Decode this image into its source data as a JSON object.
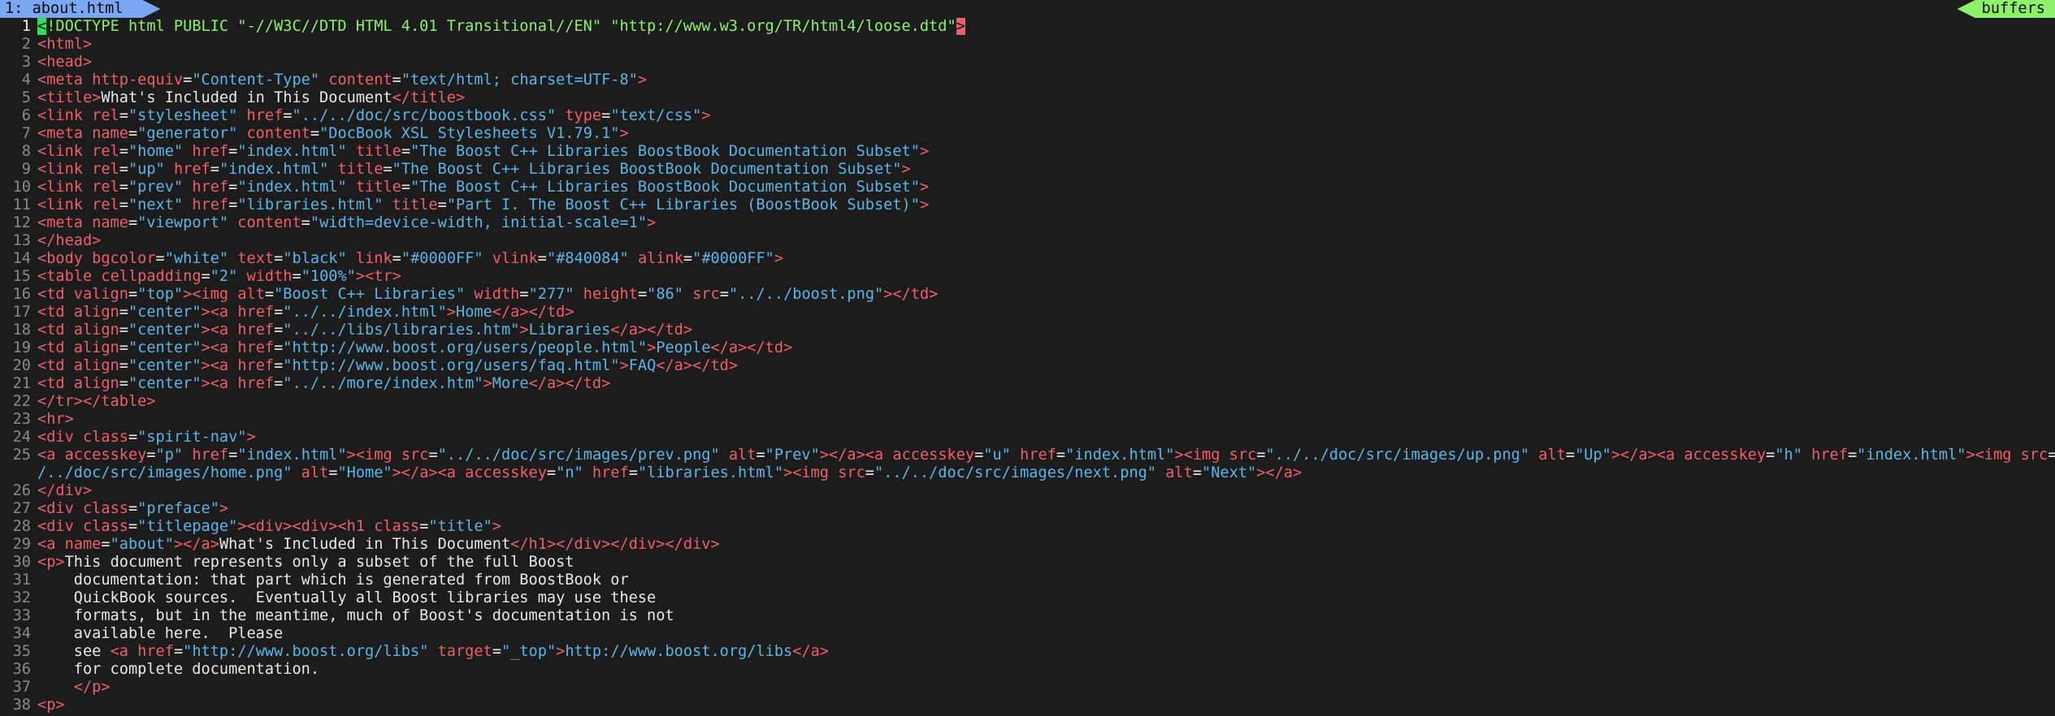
{
  "tabline": {
    "active_tab": "1: about.html",
    "buffers_label": "buffers"
  },
  "lines": [
    {
      "n": "1",
      "segs": [
        [
          "cursor-lt",
          "<"
        ],
        [
          "doctype",
          "!DOCTYPE html PUBLIC \"-//W3C//DTD HTML 4.01 Transitional//EN\" \"http://www.w3.org/TR/html4/loose.dtd\""
        ],
        [
          "cursor-gt",
          ">"
        ]
      ],
      "current": true
    },
    {
      "n": "2",
      "segs": [
        [
          "tag",
          "<html>"
        ]
      ]
    },
    {
      "n": "3",
      "segs": [
        [
          "tag",
          "<head>"
        ]
      ]
    },
    {
      "n": "4",
      "segs": [
        [
          "tag",
          "<meta "
        ],
        [
          "attr",
          "http-equiv"
        ],
        [
          "txt",
          "="
        ],
        [
          "str",
          "\"Content-Type\""
        ],
        [
          "attr",
          " content"
        ],
        [
          "txt",
          "="
        ],
        [
          "str",
          "\"text/html; charset=UTF-8\""
        ],
        [
          "tag",
          ">"
        ]
      ]
    },
    {
      "n": "5",
      "segs": [
        [
          "tag",
          "<title>"
        ],
        [
          "txt",
          "What's Included in This Document"
        ],
        [
          "tag",
          "</title>"
        ]
      ]
    },
    {
      "n": "6",
      "segs": [
        [
          "tag",
          "<link "
        ],
        [
          "attr",
          "rel"
        ],
        [
          "txt",
          "="
        ],
        [
          "str",
          "\"stylesheet\""
        ],
        [
          "attr",
          " href"
        ],
        [
          "txt",
          "="
        ],
        [
          "str",
          "\"../../doc/src/boostbook.css\""
        ],
        [
          "attr",
          " type"
        ],
        [
          "txt",
          "="
        ],
        [
          "str",
          "\"text/css\""
        ],
        [
          "tag",
          ">"
        ]
      ]
    },
    {
      "n": "7",
      "segs": [
        [
          "tag",
          "<meta "
        ],
        [
          "attr",
          "name"
        ],
        [
          "txt",
          "="
        ],
        [
          "str",
          "\"generator\""
        ],
        [
          "attr",
          " content"
        ],
        [
          "txt",
          "="
        ],
        [
          "str",
          "\"DocBook XSL Stylesheets V1.79.1\""
        ],
        [
          "tag",
          ">"
        ]
      ]
    },
    {
      "n": "8",
      "segs": [
        [
          "tag",
          "<link "
        ],
        [
          "attr",
          "rel"
        ],
        [
          "txt",
          "="
        ],
        [
          "str",
          "\"home\""
        ],
        [
          "attr",
          " href"
        ],
        [
          "txt",
          "="
        ],
        [
          "str",
          "\"index.html\""
        ],
        [
          "attr",
          " title"
        ],
        [
          "txt",
          "="
        ],
        [
          "str",
          "\"The Boost C++ Libraries BoostBook Documentation Subset\""
        ],
        [
          "tag",
          ">"
        ]
      ]
    },
    {
      "n": "9",
      "segs": [
        [
          "tag",
          "<link "
        ],
        [
          "attr",
          "rel"
        ],
        [
          "txt",
          "="
        ],
        [
          "str",
          "\"up\""
        ],
        [
          "attr",
          " href"
        ],
        [
          "txt",
          "="
        ],
        [
          "str",
          "\"index.html\""
        ],
        [
          "attr",
          " title"
        ],
        [
          "txt",
          "="
        ],
        [
          "str",
          "\"The Boost C++ Libraries BoostBook Documentation Subset\""
        ],
        [
          "tag",
          ">"
        ]
      ]
    },
    {
      "n": "10",
      "segs": [
        [
          "tag",
          "<link "
        ],
        [
          "attr",
          "rel"
        ],
        [
          "txt",
          "="
        ],
        [
          "str",
          "\"prev\""
        ],
        [
          "attr",
          " href"
        ],
        [
          "txt",
          "="
        ],
        [
          "str",
          "\"index.html\""
        ],
        [
          "attr",
          " title"
        ],
        [
          "txt",
          "="
        ],
        [
          "str",
          "\"The Boost C++ Libraries BoostBook Documentation Subset\""
        ],
        [
          "tag",
          ">"
        ]
      ]
    },
    {
      "n": "11",
      "segs": [
        [
          "tag",
          "<link "
        ],
        [
          "attr",
          "rel"
        ],
        [
          "txt",
          "="
        ],
        [
          "str",
          "\"next\""
        ],
        [
          "attr",
          " href"
        ],
        [
          "txt",
          "="
        ],
        [
          "str",
          "\"libraries.html\""
        ],
        [
          "attr",
          " title"
        ],
        [
          "txt",
          "="
        ],
        [
          "str",
          "\"Part I. The Boost C++ Libraries (BoostBook Subset)\""
        ],
        [
          "tag",
          ">"
        ]
      ]
    },
    {
      "n": "12",
      "segs": [
        [
          "tag",
          "<meta "
        ],
        [
          "attr",
          "name"
        ],
        [
          "txt",
          "="
        ],
        [
          "str",
          "\"viewport\""
        ],
        [
          "attr",
          " content"
        ],
        [
          "txt",
          "="
        ],
        [
          "str",
          "\"width=device-width, initial-scale=1\""
        ],
        [
          "tag",
          ">"
        ]
      ]
    },
    {
      "n": "13",
      "segs": [
        [
          "tag",
          "</head>"
        ]
      ]
    },
    {
      "n": "14",
      "segs": [
        [
          "tag",
          "<body "
        ],
        [
          "attr",
          "bgcolor"
        ],
        [
          "txt",
          "="
        ],
        [
          "str",
          "\"white\""
        ],
        [
          "attr",
          " text"
        ],
        [
          "txt",
          "="
        ],
        [
          "str",
          "\"black\""
        ],
        [
          "attr",
          " link"
        ],
        [
          "txt",
          "="
        ],
        [
          "str",
          "\"#0000FF\""
        ],
        [
          "attr",
          " vlink"
        ],
        [
          "txt",
          "="
        ],
        [
          "str",
          "\"#840084\""
        ],
        [
          "attr",
          " alink"
        ],
        [
          "txt",
          "="
        ],
        [
          "str",
          "\"#0000FF\""
        ],
        [
          "tag",
          ">"
        ]
      ]
    },
    {
      "n": "15",
      "segs": [
        [
          "tag",
          "<table "
        ],
        [
          "attr",
          "cellpadding"
        ],
        [
          "txt",
          "="
        ],
        [
          "str",
          "\"2\""
        ],
        [
          "attr",
          " width"
        ],
        [
          "txt",
          "="
        ],
        [
          "str",
          "\"100%\""
        ],
        [
          "tag",
          "><tr>"
        ]
      ]
    },
    {
      "n": "16",
      "segs": [
        [
          "tag",
          "<td "
        ],
        [
          "attr",
          "valign"
        ],
        [
          "txt",
          "="
        ],
        [
          "str",
          "\"top\""
        ],
        [
          "tag",
          "><img "
        ],
        [
          "attr",
          "alt"
        ],
        [
          "txt",
          "="
        ],
        [
          "str",
          "\"Boost C++ Libraries\""
        ],
        [
          "attr",
          " width"
        ],
        [
          "txt",
          "="
        ],
        [
          "str",
          "\"277\""
        ],
        [
          "attr",
          " height"
        ],
        [
          "txt",
          "="
        ],
        [
          "str",
          "\"86\""
        ],
        [
          "attr",
          " src"
        ],
        [
          "txt",
          "="
        ],
        [
          "str",
          "\"../../boost.png\""
        ],
        [
          "tag",
          "></td>"
        ]
      ]
    },
    {
      "n": "17",
      "segs": [
        [
          "tag",
          "<td "
        ],
        [
          "attr",
          "align"
        ],
        [
          "txt",
          "="
        ],
        [
          "str",
          "\"center\""
        ],
        [
          "tag",
          "><a "
        ],
        [
          "attr",
          "href"
        ],
        [
          "txt",
          "="
        ],
        [
          "str",
          "\"../../index.html\""
        ],
        [
          "tag",
          ">"
        ],
        [
          "str",
          "Home"
        ],
        [
          "tag",
          "</a></td>"
        ]
      ]
    },
    {
      "n": "18",
      "segs": [
        [
          "tag",
          "<td "
        ],
        [
          "attr",
          "align"
        ],
        [
          "txt",
          "="
        ],
        [
          "str",
          "\"center\""
        ],
        [
          "tag",
          "><a "
        ],
        [
          "attr",
          "href"
        ],
        [
          "txt",
          "="
        ],
        [
          "str",
          "\"../../libs/libraries.htm\""
        ],
        [
          "tag",
          ">"
        ],
        [
          "str",
          "Libraries"
        ],
        [
          "tag",
          "</a></td>"
        ]
      ]
    },
    {
      "n": "19",
      "segs": [
        [
          "tag",
          "<td "
        ],
        [
          "attr",
          "align"
        ],
        [
          "txt",
          "="
        ],
        [
          "str",
          "\"center\""
        ],
        [
          "tag",
          "><a "
        ],
        [
          "attr",
          "href"
        ],
        [
          "txt",
          "="
        ],
        [
          "str",
          "\"http://www.boost.org/users/people.html\""
        ],
        [
          "tag",
          ">"
        ],
        [
          "str",
          "People"
        ],
        [
          "tag",
          "</a></td>"
        ]
      ]
    },
    {
      "n": "20",
      "segs": [
        [
          "tag",
          "<td "
        ],
        [
          "attr",
          "align"
        ],
        [
          "txt",
          "="
        ],
        [
          "str",
          "\"center\""
        ],
        [
          "tag",
          "><a "
        ],
        [
          "attr",
          "href"
        ],
        [
          "txt",
          "="
        ],
        [
          "str",
          "\"http://www.boost.org/users/faq.html\""
        ],
        [
          "tag",
          ">"
        ],
        [
          "str",
          "FAQ"
        ],
        [
          "tag",
          "</a></td>"
        ]
      ]
    },
    {
      "n": "21",
      "segs": [
        [
          "tag",
          "<td "
        ],
        [
          "attr",
          "align"
        ],
        [
          "txt",
          "="
        ],
        [
          "str",
          "\"center\""
        ],
        [
          "tag",
          "><a "
        ],
        [
          "attr",
          "href"
        ],
        [
          "txt",
          "="
        ],
        [
          "str",
          "\"../../more/index.htm\""
        ],
        [
          "tag",
          ">"
        ],
        [
          "str",
          "More"
        ],
        [
          "tag",
          "</a></td>"
        ]
      ]
    },
    {
      "n": "22",
      "segs": [
        [
          "tag",
          "</tr></table>"
        ]
      ]
    },
    {
      "n": "23",
      "segs": [
        [
          "tag",
          "<hr>"
        ]
      ]
    },
    {
      "n": "24",
      "segs": [
        [
          "tag",
          "<div "
        ],
        [
          "attr",
          "class"
        ],
        [
          "txt",
          "="
        ],
        [
          "str",
          "\"spirit-nav\""
        ],
        [
          "tag",
          ">"
        ]
      ]
    },
    {
      "n": "25",
      "segs": [
        [
          "tag",
          "<a "
        ],
        [
          "attr",
          "accesskey"
        ],
        [
          "txt",
          "="
        ],
        [
          "str",
          "\"p\""
        ],
        [
          "attr",
          " href"
        ],
        [
          "txt",
          "="
        ],
        [
          "str",
          "\"index.html\""
        ],
        [
          "tag",
          "><img "
        ],
        [
          "attr",
          "src"
        ],
        [
          "txt",
          "="
        ],
        [
          "str",
          "\"../../doc/src/images/prev.png\""
        ],
        [
          "attr",
          " alt"
        ],
        [
          "txt",
          "="
        ],
        [
          "str",
          "\"Prev\""
        ],
        [
          "tag",
          "></a><a "
        ],
        [
          "attr",
          "accesskey"
        ],
        [
          "txt",
          "="
        ],
        [
          "str",
          "\"u\""
        ],
        [
          "attr",
          " href"
        ],
        [
          "txt",
          "="
        ],
        [
          "str",
          "\"index.html\""
        ],
        [
          "tag",
          "><img "
        ],
        [
          "attr",
          "src"
        ],
        [
          "txt",
          "="
        ],
        [
          "str",
          "\"../../doc/src/images/up.png\""
        ],
        [
          "attr",
          " alt"
        ],
        [
          "txt",
          "="
        ],
        [
          "str",
          "\"Up\""
        ],
        [
          "tag",
          "></a><a "
        ],
        [
          "attr",
          "accesskey"
        ],
        [
          "txt",
          "="
        ],
        [
          "str",
          "\"h\""
        ],
        [
          "attr",
          " href"
        ],
        [
          "txt",
          "="
        ],
        [
          "str",
          "\"index.html\""
        ],
        [
          "tag",
          "><img "
        ],
        [
          "attr",
          "src"
        ],
        [
          "txt",
          "="
        ],
        [
          "str",
          "\".."
        ]
      ]
    },
    {
      "n": "",
      "segs": [
        [
          "str",
          "/../doc/src/images/home.png\""
        ],
        [
          "attr",
          " alt"
        ],
        [
          "txt",
          "="
        ],
        [
          "str",
          "\"Home\""
        ],
        [
          "tag",
          "></a><a "
        ],
        [
          "attr",
          "accesskey"
        ],
        [
          "txt",
          "="
        ],
        [
          "str",
          "\"n\""
        ],
        [
          "attr",
          " href"
        ],
        [
          "txt",
          "="
        ],
        [
          "str",
          "\"libraries.html\""
        ],
        [
          "tag",
          "><img "
        ],
        [
          "attr",
          "src"
        ],
        [
          "txt",
          "="
        ],
        [
          "str",
          "\"../../doc/src/images/next.png\""
        ],
        [
          "attr",
          " alt"
        ],
        [
          "txt",
          "="
        ],
        [
          "str",
          "\"Next\""
        ],
        [
          "tag",
          "></a>"
        ]
      ]
    },
    {
      "n": "26",
      "segs": [
        [
          "tag",
          "</div>"
        ]
      ]
    },
    {
      "n": "27",
      "segs": [
        [
          "tag",
          "<div "
        ],
        [
          "attr",
          "class"
        ],
        [
          "txt",
          "="
        ],
        [
          "str",
          "\"preface\""
        ],
        [
          "tag",
          ">"
        ]
      ]
    },
    {
      "n": "28",
      "segs": [
        [
          "tag",
          "<div "
        ],
        [
          "attr",
          "class"
        ],
        [
          "txt",
          "="
        ],
        [
          "str",
          "\"titlepage\""
        ],
        [
          "tag",
          "><div><div><h1 "
        ],
        [
          "attr",
          "class"
        ],
        [
          "txt",
          "="
        ],
        [
          "str",
          "\"title\""
        ],
        [
          "tag",
          ">"
        ]
      ]
    },
    {
      "n": "29",
      "segs": [
        [
          "tag",
          "<a "
        ],
        [
          "attr",
          "name"
        ],
        [
          "txt",
          "="
        ],
        [
          "str",
          "\"about\""
        ],
        [
          "tag",
          "></a>"
        ],
        [
          "txt",
          "What's Included in This Document"
        ],
        [
          "tag",
          "</h1></div></div></div>"
        ]
      ]
    },
    {
      "n": "30",
      "segs": [
        [
          "tag",
          "<p>"
        ],
        [
          "txt",
          "This document represents only a subset of the full Boost"
        ]
      ]
    },
    {
      "n": "31",
      "segs": [
        [
          "txt",
          "    documentation: that part which is generated from BoostBook or"
        ]
      ]
    },
    {
      "n": "32",
      "segs": [
        [
          "txt",
          "    QuickBook sources.  Eventually all Boost libraries may use these"
        ]
      ]
    },
    {
      "n": "33",
      "segs": [
        [
          "txt",
          "    formats, but in the meantime, much of Boost's documentation is not"
        ]
      ]
    },
    {
      "n": "34",
      "segs": [
        [
          "txt",
          "    available here.  Please"
        ]
      ]
    },
    {
      "n": "35",
      "segs": [
        [
          "txt",
          "    see "
        ],
        [
          "tag",
          "<a "
        ],
        [
          "attr",
          "href"
        ],
        [
          "txt",
          "="
        ],
        [
          "str",
          "\"http://www.boost.org/libs\""
        ],
        [
          "attr",
          " target"
        ],
        [
          "txt",
          "="
        ],
        [
          "str",
          "\"_top\""
        ],
        [
          "tag",
          ">"
        ],
        [
          "str",
          "http://www.boost.org/libs"
        ],
        [
          "tag",
          "</a>"
        ]
      ]
    },
    {
      "n": "36",
      "segs": [
        [
          "txt",
          "    for complete documentation."
        ]
      ]
    },
    {
      "n": "37",
      "segs": [
        [
          "txt",
          "    "
        ],
        [
          "tag",
          "</p>"
        ]
      ]
    },
    {
      "n": "38",
      "segs": [
        [
          "tag",
          "<p>"
        ]
      ]
    }
  ]
}
